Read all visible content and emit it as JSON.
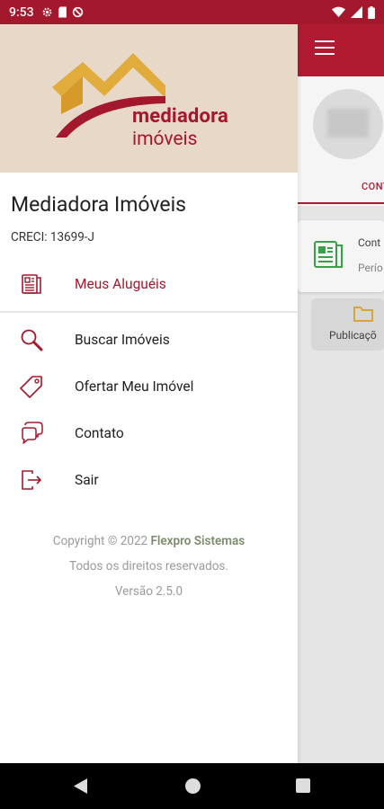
{
  "status_bar": {
    "time": "9:53",
    "icons_left": [
      "gear-icon",
      "sd-card-icon",
      "data-saver-icon"
    ],
    "icons_right": [
      "wifi-icon",
      "signal-icon",
      "battery-icon"
    ]
  },
  "background_app": {
    "tab_label": "CONT",
    "card_title": "Cont",
    "card_subtitle": "Perío",
    "publication_label": "Publicaçõ",
    "accent_color": "#b81d35"
  },
  "drawer": {
    "brand": {
      "line1": "mediadora",
      "line2": "imóveis"
    },
    "user": {
      "name": "Mediadora Imóveis",
      "creci": "CRECI: 13699-J"
    },
    "menu": [
      {
        "label": "Meus Aluguéis",
        "icon": "document-icon",
        "active": true
      },
      {
        "label": "Buscar Imóveis",
        "icon": "search-icon",
        "active": false
      },
      {
        "label": "Ofertar Meu Imóvel",
        "icon": "tag-icon",
        "active": false
      },
      {
        "label": "Contato",
        "icon": "chat-bubbles-icon",
        "active": false
      },
      {
        "label": "Sair",
        "icon": "logout-icon",
        "active": false
      }
    ],
    "footer": {
      "copyright_prefix": "Copyright © 2022",
      "company": "Flexpro Sistemas",
      "rights": "Todos os direitos reservados.",
      "version": "Versão 2.5.0"
    }
  },
  "colors": {
    "primary": "#a3182c",
    "header_bg": "#e8d8c8",
    "gold": "#e1ac3c"
  }
}
